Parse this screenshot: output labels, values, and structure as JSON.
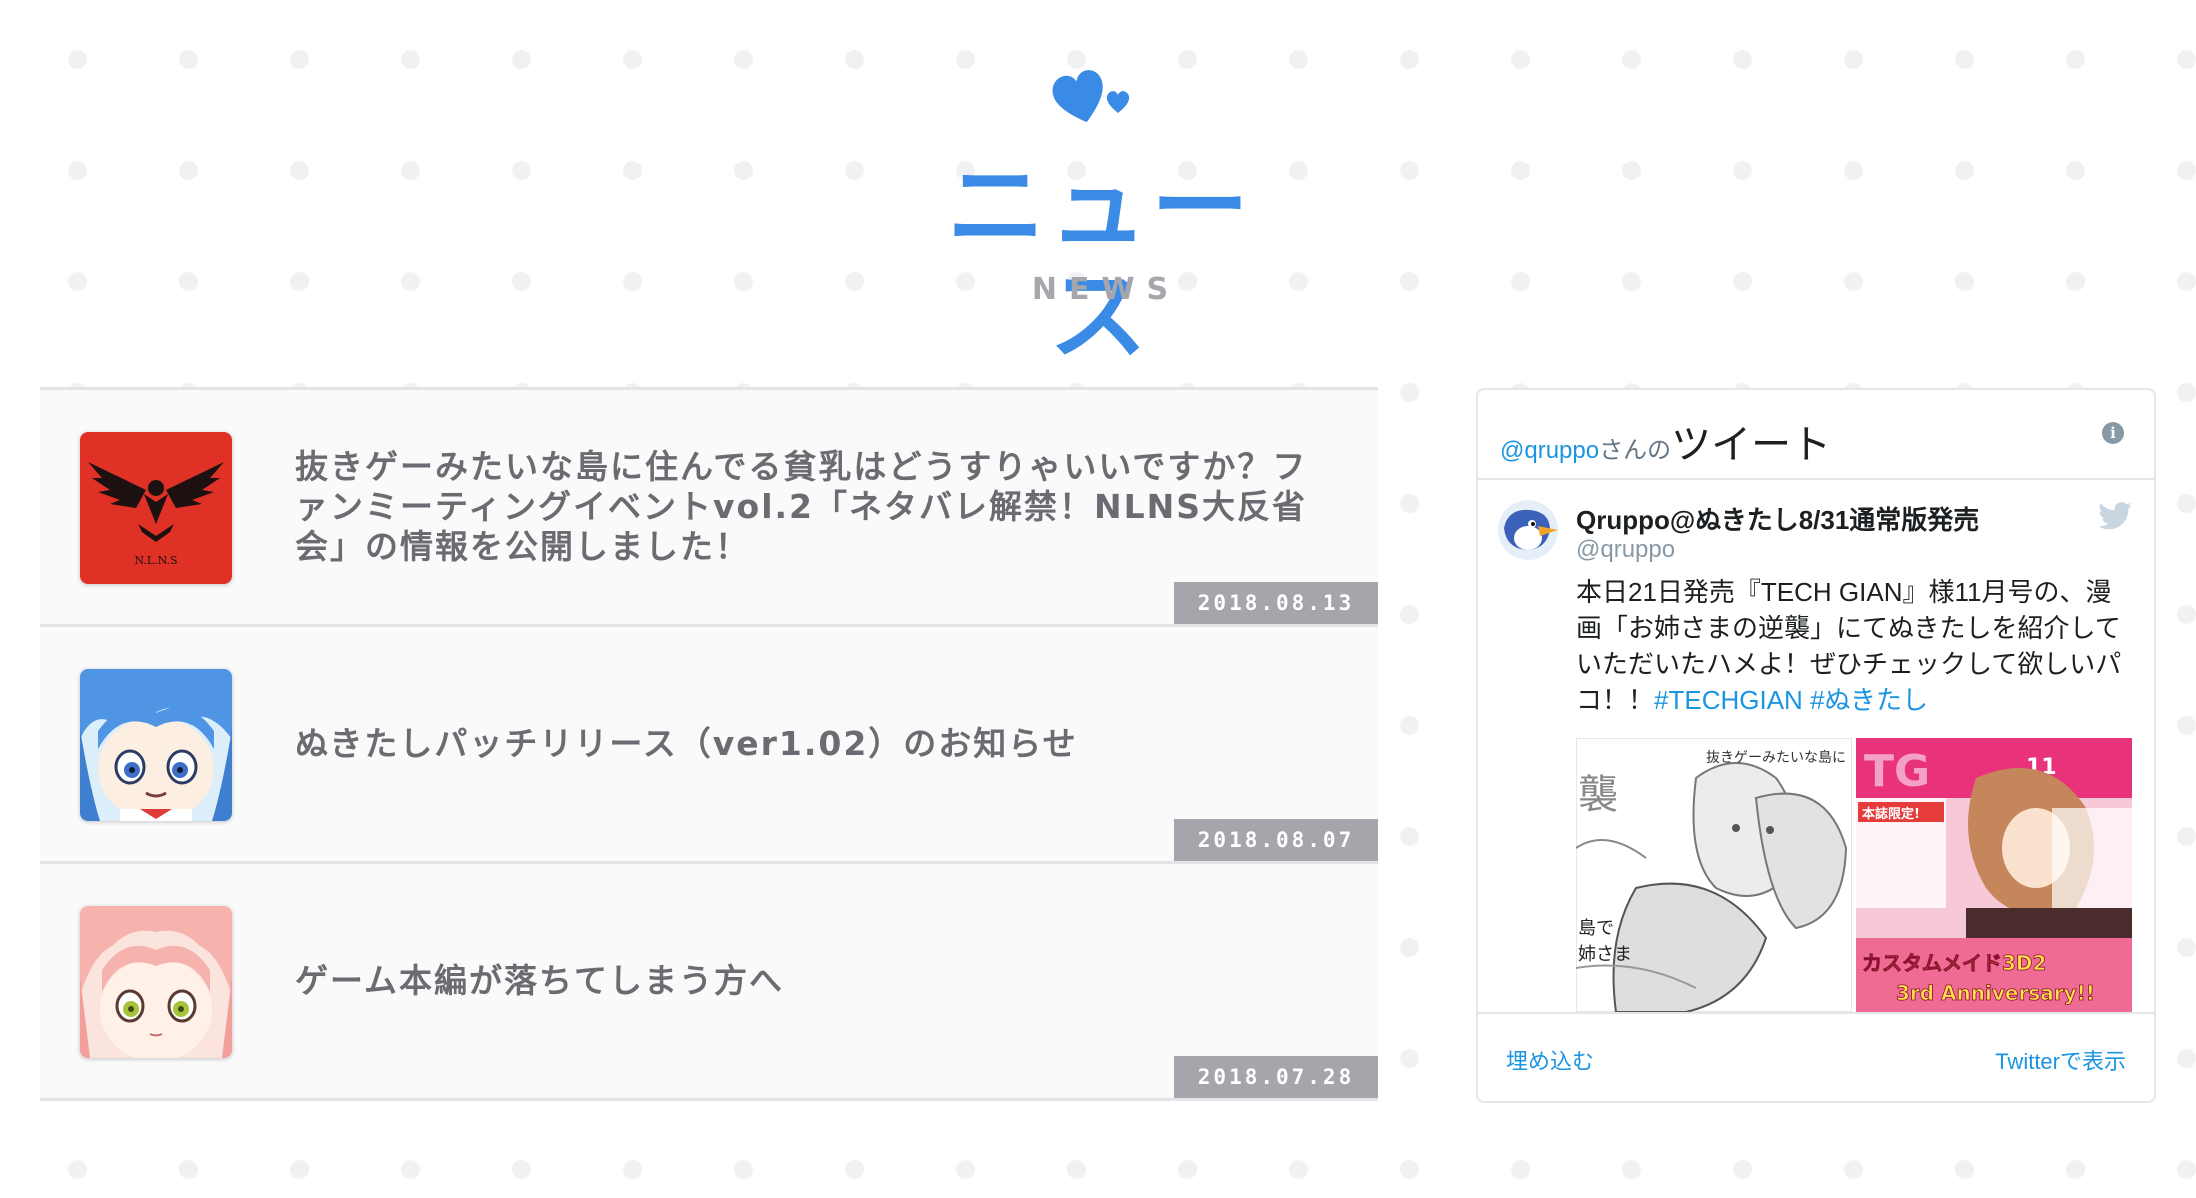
{
  "header": {
    "title": "ニュース",
    "subtitle": "NEWS",
    "heart_icon": "heart-icon",
    "accent_color": "#3a8be6"
  },
  "news": [
    {
      "title": "抜きゲーみたいな島に住んでる貧乳はどうすりゃいいですか？ファンミーティングイベントvol.2「ネタバレ解禁！NLNS大反省会」の情報を公開しました！",
      "date": "2018.08.13",
      "thumb_label": "N.L.N.S"
    },
    {
      "title": "ぬきたしパッチリリース（ver1.02）のお知らせ",
      "date": "2018.08.07"
    },
    {
      "title": "ゲーム本編が落ちてしまう方へ",
      "date": "2018.07.28"
    }
  ],
  "twitter": {
    "handle_link": "@qruppo",
    "san": "さんの",
    "tweet_word": "ツイート",
    "author_name": "Qruppo@ぬきたし8/31通常版発売",
    "author_handle": "@qruppo",
    "text": "本日21日発売『TECH GIAN』様11月号の、漫画「お姉さまの逆襲」にてぬきたしを紹介していただいたハメよ！ぜひチェックして欲しいパコ！！",
    "hashtags": [
      "#TECHGIAN",
      "#ぬきたし"
    ],
    "image_left_caption": "抜きゲーみたいな島に",
    "image_left_side": "襲",
    "image_left_bottom1": "島で",
    "image_left_bottom2": "姉さま",
    "image_right_top": "11",
    "image_right_badge": "本誌限定!",
    "image_right_title": "カスタムメイド3D2",
    "image_right_subtitle": "3rd Anniversary!!",
    "embed_label": "埋め込む",
    "view_label": "Twitterで表示",
    "link_color": "#1b95e0"
  }
}
